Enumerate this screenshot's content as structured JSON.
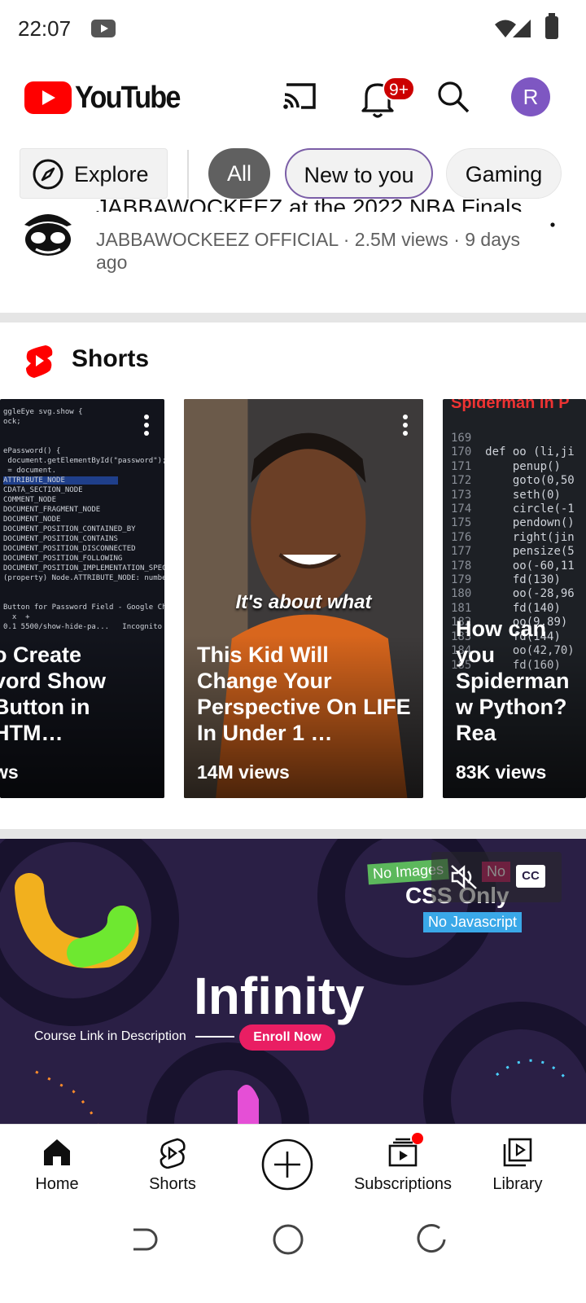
{
  "status_bar": {
    "time": "22:07"
  },
  "header": {
    "logo_text": "YouTube",
    "notification_badge": "9+",
    "avatar_letter": "R"
  },
  "chips": {
    "explore": "Explore",
    "all": "All",
    "new_to_you": "New to you",
    "gaming": "Gaming"
  },
  "video": {
    "title": "JABBAWOCKEEZ at the 2022 NBA Finals",
    "meta": "JABBAWOCKEEZ OFFICIAL · 2.5M views · 9 days ago"
  },
  "shorts": {
    "heading": "Shorts",
    "items": [
      {
        "title": "o Create\nvord Show\nButton in HTM…",
        "views": "ws"
      },
      {
        "title": "This Kid Will Change Your Perspective On LIFE In Under 1 …",
        "views": "14M views",
        "caption": "It's about what"
      },
      {
        "title": "How can you Spiderman w Python? Rea",
        "views": "83K views",
        "banner": "Spiderman in P"
      }
    ]
  },
  "ad": {
    "headline": "Infinity",
    "course_text": "Course Link in Description",
    "enroll": "Enroll Now",
    "tag_images": "No Images",
    "tag_no": "No",
    "css_only": "CSS Only",
    "no_js": "No Javascript",
    "cc": "CC"
  },
  "bottom_nav": {
    "home": "Home",
    "shorts": "Shorts",
    "subscriptions": "Subscriptions",
    "library": "Library"
  },
  "colors": {
    "brand_red": "#ff0000",
    "avatar": "#7e57c2",
    "chip_active": "#606060",
    "enroll": "#e91e63"
  }
}
